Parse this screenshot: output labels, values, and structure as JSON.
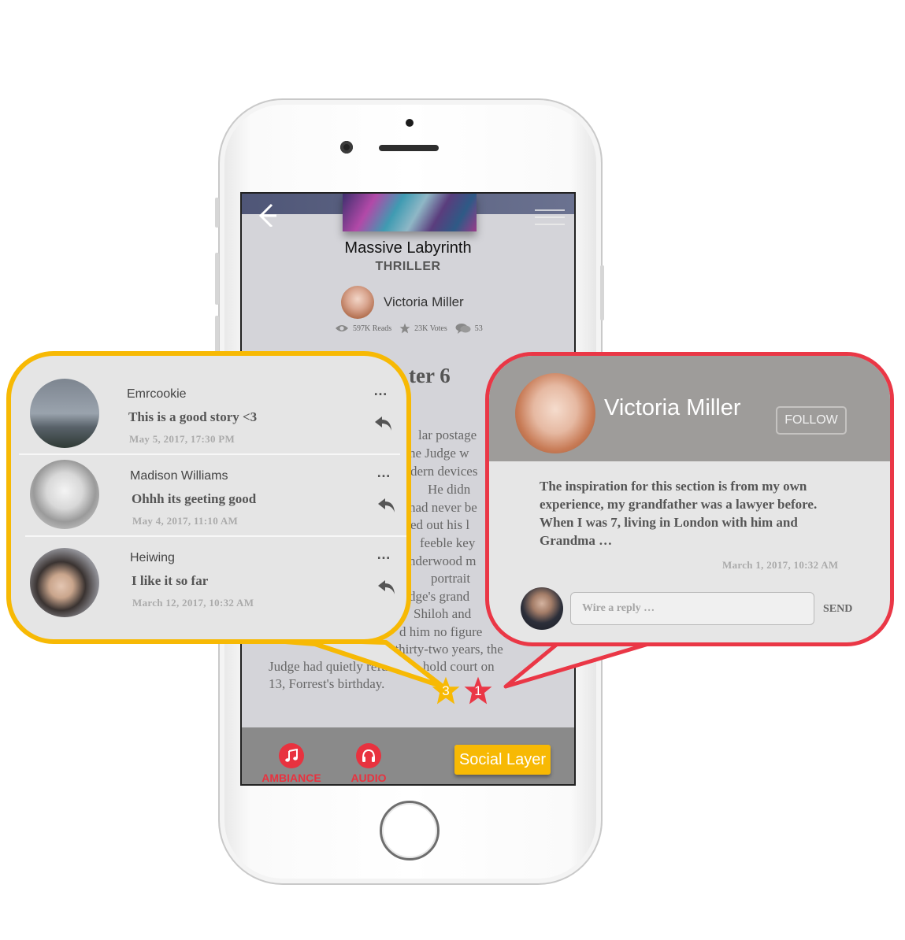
{
  "book": {
    "title": "Massive Labyrinth",
    "genre": "THRILLER",
    "author": "Victoria Miller",
    "stats": {
      "reads": "597K Reads",
      "votes": "23K Votes",
      "comments": "53"
    },
    "chapter_fragment": "ter 6",
    "text_fragments": [
      "lar postage",
      "he Judge w",
      "dern devices",
      "He didn",
      "had never be",
      "ed out his l",
      "feeble key",
      "nderwood m",
      "portrait",
      "dge's grand",
      "Shiloh and",
      "d him no figure",
      "ed. For thirty-two years, the",
      "Judge had quietly refused to hold court on",
      "13, Forrest's birthday."
    ]
  },
  "toolbar": {
    "ambiance_label": "AMBIANCE",
    "audio_label": "AUDIO",
    "social_label": "Social Layer"
  },
  "markers": {
    "comments_count": "3",
    "author_notes_count": "1"
  },
  "comments": [
    {
      "user": "Emrcookie",
      "text": "This is a good story <3",
      "date": "May 5, 2017, 17:30 PM",
      "more": "…"
    },
    {
      "user": "Madison Williams",
      "text": "Ohhh its geeting good",
      "date": "May 4, 2017, 11:10 AM",
      "more": "…"
    },
    {
      "user": "Heiwing",
      "text": "I like it so far",
      "date": "March 12, 2017, 10:32 AM",
      "more": "…"
    }
  ],
  "author_note": {
    "name": "Victoria Miller",
    "follow_label": "FOLLOW",
    "lines": [
      "The inspiration for this section is from my own",
      "experience, my grandfather was a lawyer before.",
      "When I was 7, living in London with him and",
      "Grandma …"
    ],
    "date": "March 1, 2017, 10:32 AM",
    "reply_placeholder": "Wire a reply …",
    "send_label": "SEND"
  },
  "colors": {
    "comments_accent": "#f7b904",
    "author_accent": "#ea3746",
    "header_gray": "#9e9c9a"
  }
}
